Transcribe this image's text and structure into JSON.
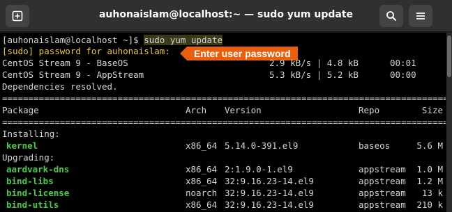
{
  "window": {
    "title": "auhonaislam@localhost:~ — sudo yum update",
    "buttons": {
      "new_tab": "new-tab-icon",
      "search": "search-icon",
      "menu": "hamburger-menu-icon"
    }
  },
  "annotation": {
    "text": "Enter user password",
    "color": "#e8600f"
  },
  "terminal": {
    "prompt": "[auhonaislam@localhost ~]$ ",
    "command": "sudo yum update",
    "sudo_prompt": "[sudo] password for auhonaislam:",
    "repos": [
      {
        "name": "CentOS Stream 9 - BaseOS",
        "rate": "2.9 kB/s | 4.8 kB",
        "time": "00:01"
      },
      {
        "name": "CentOS Stream 9 - AppStream",
        "rate": "5.3 kB/s | 5.2 kB",
        "time": "00:00"
      }
    ],
    "deps_resolved": "Dependencies resolved.",
    "separator": "================================================================================================================================",
    "headers": {
      "package": "Package",
      "arch": "Arch",
      "version": "Version",
      "repo": "Repo",
      "size": "Size"
    },
    "installing_label": "Installing:",
    "installing": [
      {
        "package": "kernel",
        "arch": "x86_64",
        "version": "5.14.0-391.el9",
        "repo": "baseos",
        "size": "5.6 M"
      }
    ],
    "upgrading_label": "Upgrading:",
    "upgrading": [
      {
        "package": "aardvark-dns",
        "arch": "x86_64",
        "version": "2:1.9.0-1.el9",
        "repo": "appstream",
        "size": "1.0 M"
      },
      {
        "package": "bind-libs",
        "arch": "x86_64",
        "version": "32:9.16.23-14.el9",
        "repo": "appstream",
        "size": "1.2 M"
      },
      {
        "package": "bind-license",
        "arch": "noarch",
        "version": "32:9.16.23-14.el9",
        "repo": "appstream",
        "size": "13 k"
      },
      {
        "package": "bind-utils",
        "arch": "x86_64",
        "version": "32:9.16.23-14.el9",
        "repo": "appstream",
        "size": "210 k"
      }
    ]
  }
}
